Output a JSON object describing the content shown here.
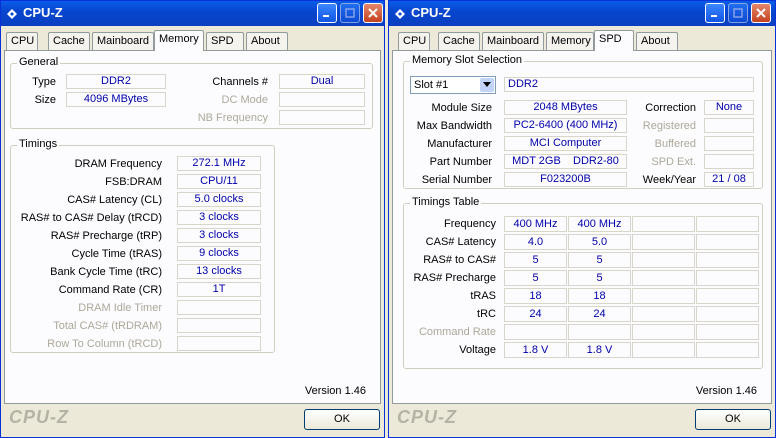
{
  "left": {
    "title": "CPU-Z",
    "tabs": [
      "CPU",
      "Cache",
      "Mainboard",
      "Memory",
      "SPD",
      "About"
    ],
    "active_tab": "Memory",
    "general": {
      "label": "General",
      "type_label": "Type",
      "type": "DDR2",
      "size_label": "Size",
      "size": "4096 MBytes",
      "channels_label": "Channels #",
      "channels": "Dual",
      "dc_mode_label": "DC Mode",
      "dc_mode": "",
      "nb_freq_label": "NB Frequency",
      "nb_freq": ""
    },
    "timings": {
      "label": "Timings",
      "rows": [
        {
          "label": "DRAM Frequency",
          "value": "272.1 MHz",
          "enabled": true
        },
        {
          "label": "FSB:DRAM",
          "value": "CPU/11",
          "enabled": true
        },
        {
          "label": "CAS# Latency (CL)",
          "value": "5.0 clocks",
          "enabled": true
        },
        {
          "label": "RAS# to CAS# Delay (tRCD)",
          "value": "3 clocks",
          "enabled": true
        },
        {
          "label": "RAS# Precharge (tRP)",
          "value": "3 clocks",
          "enabled": true
        },
        {
          "label": "Cycle Time (tRAS)",
          "value": "9 clocks",
          "enabled": true
        },
        {
          "label": "Bank Cycle Time (tRC)",
          "value": "13 clocks",
          "enabled": true
        },
        {
          "label": "Command Rate (CR)",
          "value": "1T",
          "enabled": true
        },
        {
          "label": "DRAM Idle Timer",
          "value": "",
          "enabled": false
        },
        {
          "label": "Total CAS# (tRDRAM)",
          "value": "",
          "enabled": false
        },
        {
          "label": "Row To Column (tRCD)",
          "value": "",
          "enabled": false
        }
      ]
    },
    "version": "Version 1.46",
    "brand": "CPU-Z",
    "ok": "OK"
  },
  "right": {
    "title": "CPU-Z",
    "tabs": [
      "CPU",
      "Cache",
      "Mainboard",
      "Memory",
      "SPD",
      "About"
    ],
    "active_tab": "SPD",
    "slot": {
      "label": "Memory Slot Selection",
      "selected": "Slot #1",
      "type": "DDR2",
      "module_size_label": "Module Size",
      "module_size": "2048 MBytes",
      "max_bw_label": "Max Bandwidth",
      "max_bw": "PC2-6400 (400 MHz)",
      "manufacturer_label": "Manufacturer",
      "manufacturer": "MCI Computer",
      "part_label": "Part Number",
      "part": "MDT 2GB    DDR2-80",
      "serial_label": "Serial Number",
      "serial": "F023200B",
      "correction_label": "Correction",
      "correction": "None",
      "registered_label": "Registered",
      "registered": "",
      "buffered_label": "Buffered",
      "buffered": "",
      "spd_ext_label": "SPD Ext.",
      "spd_ext": "",
      "week_year_label": "Week/Year",
      "week_year": "21 / 08"
    },
    "timings_table": {
      "label": "Timings Table",
      "rows": [
        {
          "label": "Frequency",
          "values": [
            "400 MHz",
            "400 MHz",
            "",
            ""
          ],
          "enabled": true
        },
        {
          "label": "CAS# Latency",
          "values": [
            "4.0",
            "5.0",
            "",
            ""
          ],
          "enabled": true
        },
        {
          "label": "RAS# to CAS#",
          "values": [
            "5",
            "5",
            "",
            ""
          ],
          "enabled": true
        },
        {
          "label": "RAS# Precharge",
          "values": [
            "5",
            "5",
            "",
            ""
          ],
          "enabled": true
        },
        {
          "label": "tRAS",
          "values": [
            "18",
            "18",
            "",
            ""
          ],
          "enabled": true
        },
        {
          "label": "tRC",
          "values": [
            "24",
            "24",
            "",
            ""
          ],
          "enabled": true
        },
        {
          "label": "Command Rate",
          "values": [
            "",
            "",
            "",
            ""
          ],
          "enabled": false
        },
        {
          "label": "Voltage",
          "values": [
            "1.8 V",
            "1.8 V",
            "",
            ""
          ],
          "enabled": true
        }
      ]
    },
    "version": "Version 1.46",
    "brand": "CPU-Z",
    "ok": "OK"
  }
}
